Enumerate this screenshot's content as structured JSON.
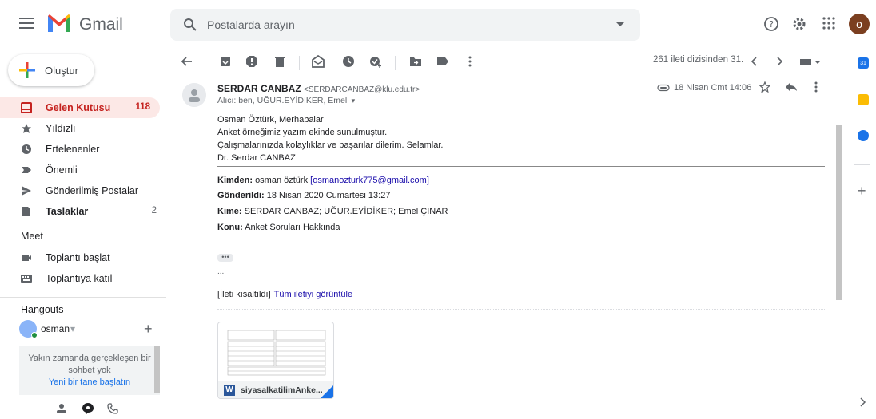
{
  "app": {
    "name": "Gmail"
  },
  "search": {
    "placeholder": "Postalarda arayın"
  },
  "account": {
    "initial": "o"
  },
  "compose": {
    "label": "Oluştur"
  },
  "nav": {
    "items": [
      {
        "label": "Gelen Kutusu",
        "count": "118",
        "icon": "inbox-icon"
      },
      {
        "label": "Yıldızlı",
        "count": "",
        "icon": "star-icon"
      },
      {
        "label": "Ertelenenler",
        "count": "",
        "icon": "clock-icon"
      },
      {
        "label": "Önemli",
        "count": "",
        "icon": "important-icon"
      },
      {
        "label": "Gönderilmiş Postalar",
        "count": "",
        "icon": "send-icon"
      },
      {
        "label": "Taslaklar",
        "count": "2",
        "icon": "draft-icon"
      }
    ]
  },
  "meet": {
    "title": "Meet",
    "items": [
      {
        "label": "Toplantı başlat",
        "icon": "video-icon"
      },
      {
        "label": "Toplantıya katıl",
        "icon": "keyboard-icon"
      }
    ]
  },
  "hangouts": {
    "title": "Hangouts",
    "user": "osman",
    "empty_line1": "Yakın zamanda gerçekleşen bir",
    "empty_line2": "sohbet yok",
    "start_link": "Yeni bir tane başlatın"
  },
  "pager": {
    "text": "261 ileti dizisinden 31."
  },
  "email": {
    "sender_name": "SERDAR CANBAZ",
    "sender_email": "<SERDARCANBAZ@klu.edu.tr>",
    "recipients": "Alıcı: ben, UĞUR.EYİDİKER, Emel",
    "date": "18 Nisan Cmt 14:06",
    "body": [
      "Osman Öztürk, Merhabalar",
      "Anket örneğimiz yazım ekinde sunulmuştur.",
      "Çalışmalarınızda kolaylıklar ve başarılar dilerim. Selamlar.",
      "Dr. Serdar CANBAZ"
    ],
    "forward": {
      "from_label": "Kimden:",
      "from_name": "osman öztürk",
      "from_email": "[osmanozturk775@gmail.com]",
      "sent_label": "Gönderildi:",
      "sent_value": "18 Nisan 2020 Cumartesi 13:27",
      "to_label": "Kime:",
      "to_value": "SERDAR CANBAZ; UĞUR.EYİDİKER; Emel ÇINAR",
      "subject_label": "Konu:",
      "subject_value": "Anket Soruları Hakkında"
    },
    "more_dots": "•••",
    "ellipsis": "...",
    "clipped_label": "[İleti kısaltıldı]",
    "view_full": "Tüm iletiyi görüntüle",
    "attachment": {
      "filename": "siyasalkatilimAnke...",
      "type_letter": "W"
    }
  },
  "colors": {
    "accent_red": "#c5221f",
    "active_bg": "#fce8e6",
    "link": "#1a0dab"
  }
}
